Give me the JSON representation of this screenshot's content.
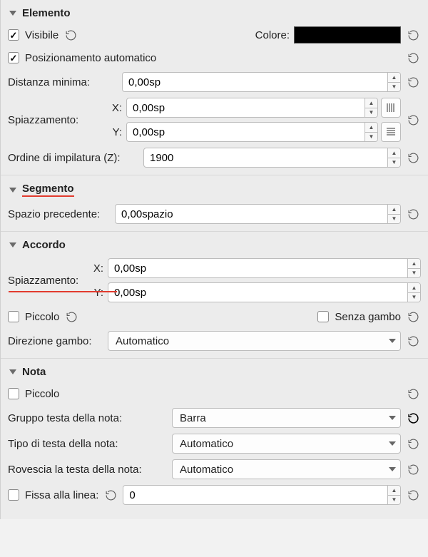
{
  "sections": {
    "elemento": {
      "title": "Elemento",
      "visibile_label": "Visibile",
      "visibile_checked": true,
      "colore_label": "Colore:",
      "colore_value": "#000000",
      "posizionamento_label": "Posizionamento automatico",
      "posizionamento_checked": true,
      "distanza_label": "Distanza minima:",
      "distanza_value": "0,00sp",
      "spiazzamento_label": "Spiazzamento:",
      "x_label": "X:",
      "x_value": "0,00sp",
      "y_label": "Y:",
      "y_value": "0,00sp",
      "ordine_label": "Ordine di impilatura  (Z):",
      "ordine_value": "1900"
    },
    "segmento": {
      "title": "Segmento",
      "spazio_label": "Spazio precedente:",
      "spazio_value": "0,00spazio"
    },
    "accordo": {
      "title": "Accordo",
      "spiazzamento_label": "Spiazzamento:",
      "x_label": "X:",
      "x_value": "0,00sp",
      "y_label": "Y:",
      "y_value": "0,00sp",
      "piccolo_label": "Piccolo",
      "piccolo_checked": false,
      "senza_gambo_label": "Senza gambo",
      "senza_gambo_checked": false,
      "direzione_label": "Direzione gambo:",
      "direzione_value": "Automatico"
    },
    "nota": {
      "title": "Nota",
      "piccolo_label": "Piccolo",
      "piccolo_checked": false,
      "gruppo_label": "Gruppo testa della nota:",
      "gruppo_value": "Barra",
      "tipo_label": "Tipo di testa della nota:",
      "tipo_value": "Automatico",
      "rovescia_label": "Rovescia la testa della nota:",
      "rovescia_value": "Automatico",
      "fissa_label": "Fissa alla linea:",
      "fissa_checked": false,
      "fissa_value": "0"
    }
  }
}
